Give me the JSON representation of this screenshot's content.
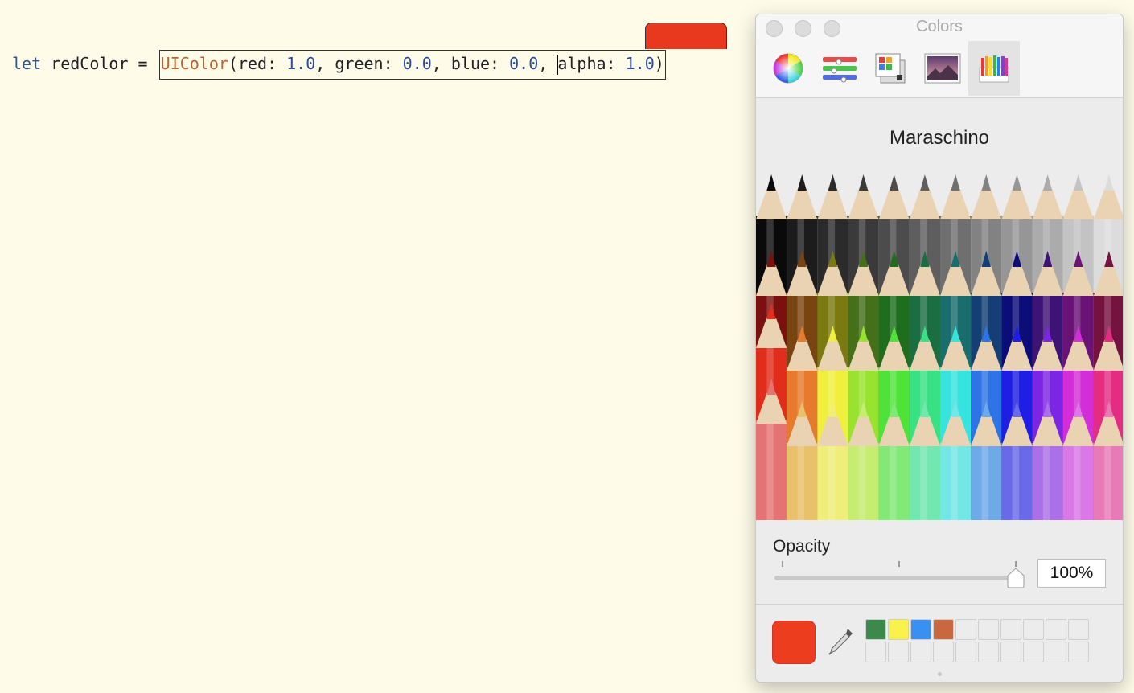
{
  "editor": {
    "kw_let": "let",
    "var_name": " redColor = ",
    "class_name": "UIColor",
    "open": "(red: ",
    "red": "1.0",
    "green_label": ", green: ",
    "green": "0.0",
    "blue_label": ", blue: ",
    "blue": "0.0",
    "alpha_sep": ", ",
    "alpha_label": "alpha: ",
    "alpha": "1.0",
    "close": ")",
    "swatch_color": "#e8391e"
  },
  "panel": {
    "title": "Colors",
    "modes": [
      "color-wheel",
      "color-sliders",
      "color-palettes",
      "image-palettes",
      "pencils"
    ],
    "active_mode": "pencils",
    "selected_name": "Maraschino",
    "opacity_label": "Opacity",
    "opacity_value": "100%",
    "opacity_fraction": 1.0,
    "current_color": "#ec3d1f",
    "favorites": [
      "#3b8a4b",
      "#f9f24c",
      "#3a90f0",
      "#c9683f"
    ],
    "favorites_total": 20
  },
  "pencil_rows": [
    [
      "#0a0a0a",
      "#1c1c1c",
      "#2b2b2b",
      "#3a3a3a",
      "#4c4c4c",
      "#5e5e5e",
      "#6f6f6f",
      "#828282",
      "#969696",
      "#ababab",
      "#c3c3c3",
      "#dcdcdc"
    ],
    [
      "#7a1010",
      "#7a4410",
      "#7a7a10",
      "#44701a",
      "#1e6e1e",
      "#1a6e42",
      "#196d6d",
      "#133f75",
      "#0d0d7a",
      "#3f1276",
      "#6a1276",
      "#761240"
    ],
    [
      "#e02d1c",
      "#e77a2c",
      "#f1ef3e",
      "#98e32f",
      "#4fe33a",
      "#38e284",
      "#37e3df",
      "#2d75e6",
      "#1e1ee4",
      "#7c25e3",
      "#d32ed7",
      "#e32c82"
    ],
    [
      "#e47474",
      "#e8c16a",
      "#f0ee7a",
      "#c6ec72",
      "#82e876",
      "#72e7b0",
      "#73e6e6",
      "#6ea9e8",
      "#6a6ae8",
      "#ab70e8",
      "#d978e6",
      "#e87ab7"
    ]
  ]
}
